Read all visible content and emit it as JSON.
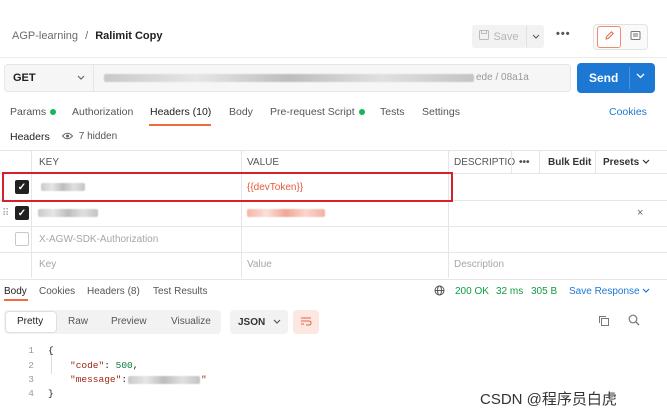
{
  "breadcrumb": {
    "collection": "AGP-learning",
    "separator": "/",
    "request": "Ralimit Copy"
  },
  "toolbar": {
    "save_label": "Save",
    "more_label": "•••"
  },
  "request": {
    "method": "GET",
    "url_tail": "ede / 08a1a",
    "send_label": "Send"
  },
  "request_tabs": {
    "params": "Params",
    "authorization": "Authorization",
    "headers": "Headers (10)",
    "body": "Body",
    "prerequest": "Pre-request Script",
    "tests": "Tests",
    "settings": "Settings",
    "cookies": "Cookies"
  },
  "headers_section": {
    "title": "Headers",
    "hidden_toggle": "7 hidden"
  },
  "table": {
    "columns": {
      "key": "KEY",
      "value": "VALUE",
      "description": "DESCRIPTIO",
      "more": "•••",
      "bulk_edit": "Bulk Edit",
      "presets": "Presets"
    },
    "rows": [
      {
        "checked": true,
        "key": "",
        "value": "{{devToken}}"
      },
      {
        "checked": true,
        "key": "",
        "value": ""
      },
      {
        "checked": false,
        "key": "X-AGW-SDK-Authorization",
        "value": ""
      }
    ],
    "placeholders": {
      "key": "Key",
      "value": "Value",
      "description": "Description"
    }
  },
  "response": {
    "tabs": {
      "body": "Body",
      "cookies": "Cookies",
      "headers": "Headers (8)",
      "tests": "Test Results"
    },
    "status": "200 OK",
    "time": "32 ms",
    "size": "305 B",
    "save_response": "Save Response",
    "views": {
      "pretty": "Pretty",
      "raw": "Raw",
      "preview": "Preview",
      "visualize": "Visualize"
    },
    "format": "JSON",
    "code": {
      "line_numbers": [
        "1",
        "2",
        "3",
        "4"
      ],
      "open_brace": "{",
      "code_key": "\"code\"",
      "code_value": "500",
      "message_key": "\"message\"",
      "message_value_tail": "\"",
      "close_brace": "}"
    }
  },
  "watermark": "CSDN @程序员白虎",
  "colors": {
    "accent": "#f26b3a",
    "send": "#1d78d4",
    "highlight": "#d5222a",
    "status_ok": "#0e9b42"
  }
}
